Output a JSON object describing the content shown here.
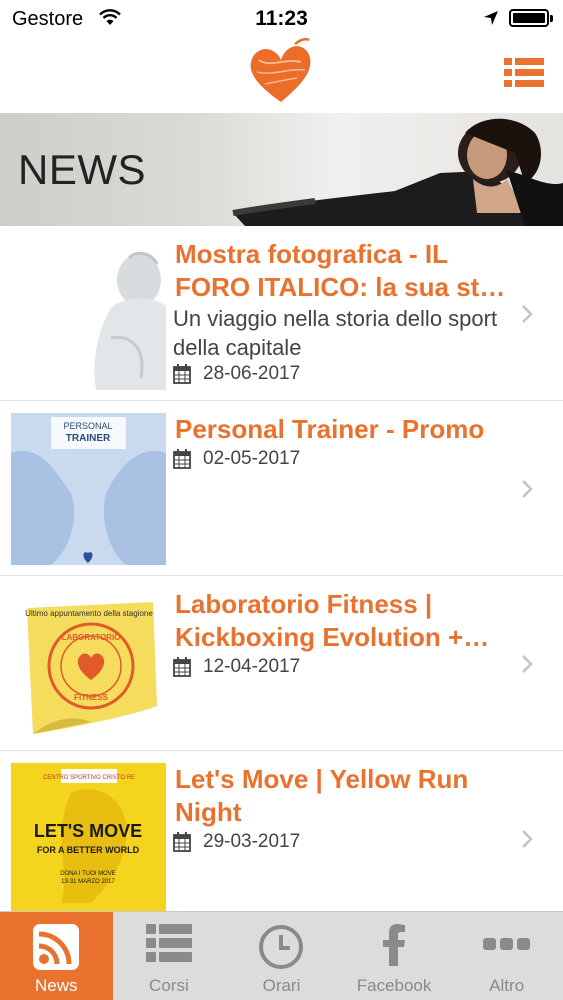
{
  "status_bar": {
    "carrier": "Gestore",
    "time": "11:23"
  },
  "header": {
    "logo_icon": "heart-logo",
    "menu_icon": "list-menu-icon"
  },
  "banner": {
    "title": "NEWS"
  },
  "news": [
    {
      "title": "Mostra fotografica - IL FORO ITALICO: la sua st…",
      "description": "Un viaggio nella storia dello sport della capitale",
      "date": "28-06-2017"
    },
    {
      "title": "Personal Trainer - Promo",
      "description": "",
      "date": "02-05-2017",
      "thumb_text": {
        "line1": "PERSONAL",
        "line2": "TRAINER"
      }
    },
    {
      "title": "Laboratorio Fitness | Kickboxing Evolution +…",
      "description": "",
      "date": "12-04-2017",
      "thumb_text": {
        "top": "Ultimo appuntamento della stagione",
        "ring_top": "LABORATORIO",
        "ring_bottom": "FITNESS"
      }
    },
    {
      "title": "Let's Move | Yellow Run Night",
      "description": "",
      "date": "29-03-2017",
      "thumb_text": {
        "brand": "CENTRO SPORTIVO CRISTO RE",
        "headline": "LET'S MOVE",
        "sub": "FOR A BETTER WORLD",
        "line1": "DONA I TUOI MOVE",
        "line2": "13-31 MARZO 2017"
      }
    }
  ],
  "tabs": [
    {
      "label": "News",
      "icon": "rss-icon",
      "active": true
    },
    {
      "label": "Corsi",
      "icon": "list-icon",
      "active": false
    },
    {
      "label": "Orari",
      "icon": "clock-icon",
      "active": false
    },
    {
      "label": "Facebook",
      "icon": "facebook-icon",
      "active": false
    },
    {
      "label": "Altro",
      "icon": "more-icon",
      "active": false
    }
  ],
  "colors": {
    "accent": "#e8722e",
    "tabbar_bg": "#dcdcdc",
    "tab_inactive": "#8a8a8a"
  }
}
